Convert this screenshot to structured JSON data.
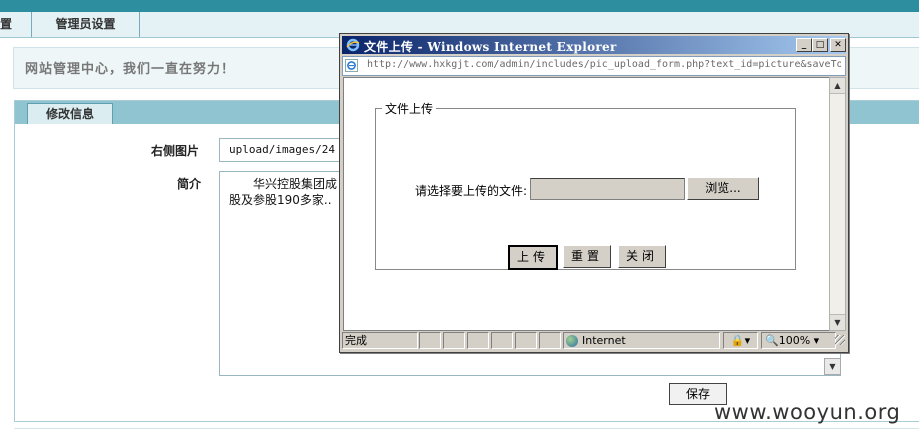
{
  "nav": {
    "tabs": [
      "置",
      "管理员设置"
    ]
  },
  "welcome": {
    "text": "网站管理中心，我们一直在努力！"
  },
  "form": {
    "tab_label": "修改信息",
    "image_label": "右侧图片",
    "image_value": "upload/images/24",
    "intro_label": "简介",
    "intro_line1": "　　华兴控股集团成",
    "intro_line2": "股及参股190多家..",
    "save_label": "保存"
  },
  "popup": {
    "title": "文件上传 - Windows Internet Explorer",
    "address": "http://www.hxkgjt.com/admin/includes/pic_upload_form.php?text_id=picture&saveTo",
    "fieldset_legend": "文件上传",
    "choose_label": "请选择要上传的文件:",
    "browse_label": "浏览...",
    "upload_label": "上传",
    "reset_label": "重置",
    "close_label": "关闭",
    "status": {
      "done": "完成",
      "zone": "Internet",
      "zoom": "100%"
    }
  },
  "watermark": "www.wooyun.org"
}
